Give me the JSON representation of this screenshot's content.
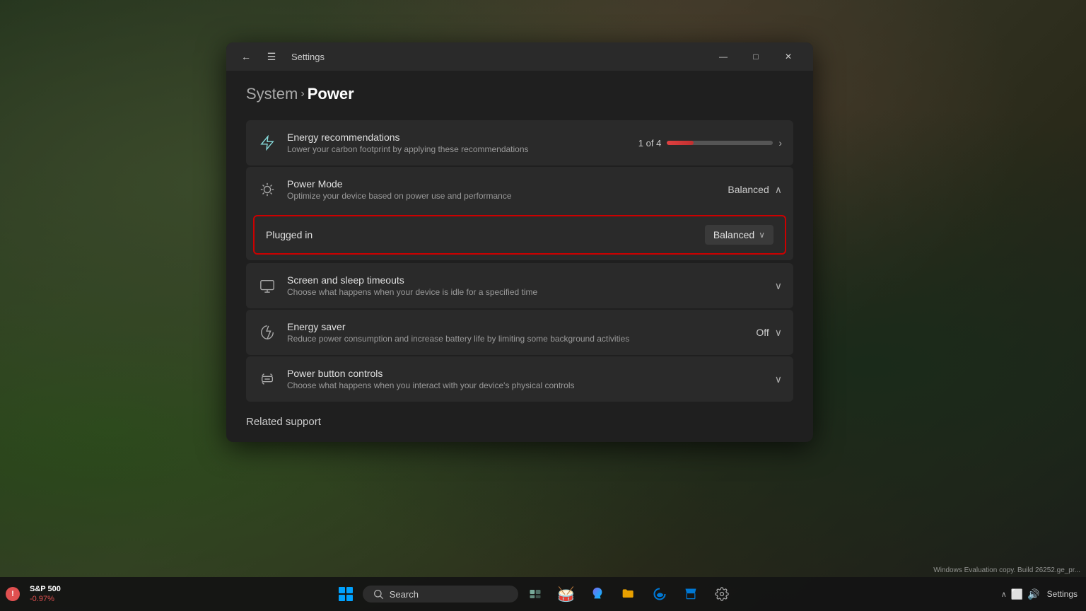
{
  "desktop": {
    "background": "#2a3a2a"
  },
  "window": {
    "title": "Settings",
    "breadcrumb": {
      "system": "System",
      "arrow": "›",
      "current": "Power"
    }
  },
  "settings_items": {
    "energy_recommendations": {
      "title": "Energy recommendations",
      "description": "Lower your carbon footprint by applying these recommendations",
      "count": "1 of 4",
      "bar_percent": 25
    },
    "power_mode": {
      "title": "Power Mode",
      "description": "Optimize your device based on power use and performance",
      "value": "Balanced"
    },
    "plugged_in": {
      "label": "Plugged in",
      "value": "Balanced"
    },
    "screen_sleep": {
      "title": "Screen and sleep timeouts",
      "description": "Choose what happens when your device is idle for a specified time"
    },
    "energy_saver": {
      "title": "Energy saver",
      "description": "Reduce power consumption and increase battery life by limiting some background activities",
      "value": "Off"
    },
    "power_button": {
      "title": "Power button controls",
      "description": "Choose what happens when you interact with your device's physical controls"
    }
  },
  "related_support": {
    "label": "Related support"
  },
  "titlebar": {
    "back_arrow": "←",
    "hamburger": "☰",
    "title": "Settings",
    "minimize": "—",
    "maximize": "□",
    "close": "✕"
  },
  "taskbar": {
    "stock": {
      "name": "S&P 500",
      "change": "-0.97%"
    },
    "search_label": "Search",
    "settings_label": "Settings"
  },
  "eval_text": "Windows\nEvaluation copy. Build 26252.ge_pr..."
}
